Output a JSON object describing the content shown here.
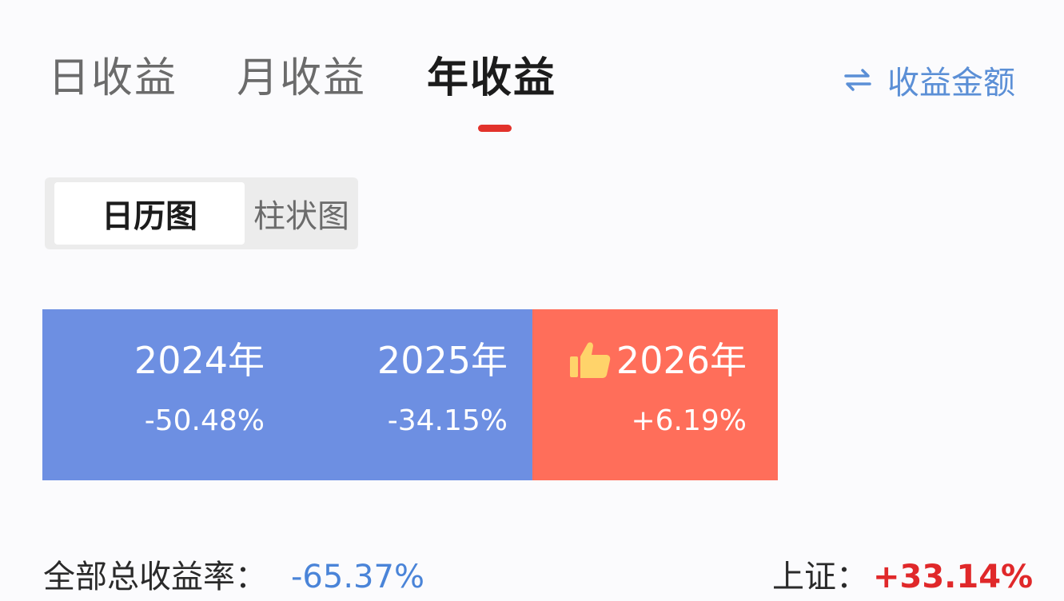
{
  "tabs": [
    {
      "label": "日收益",
      "active": false
    },
    {
      "label": "月收益",
      "active": false
    },
    {
      "label": "年收益",
      "active": true
    }
  ],
  "switch_label": "收益金额",
  "switch_icon": "swap-arrows-icon",
  "view_toggle": [
    {
      "label": "日历图",
      "selected": true
    },
    {
      "label": "柱状图",
      "selected": false
    }
  ],
  "years": [
    {
      "year": "2024年",
      "return": "-50.48%",
      "status": "loss"
    },
    {
      "year": "2025年",
      "return": "-34.15%",
      "status": "loss"
    },
    {
      "year": "2026年",
      "return": "+6.19%",
      "status": "gain",
      "badge_icon": "thumbs-up-icon"
    }
  ],
  "summary": {
    "total_label": "全部总收益率：",
    "total_value": "-65.37%",
    "index_label": "上证：",
    "index_value": "+33.14%"
  },
  "colors": {
    "accent_red": "#e2322b",
    "loss_blue": "#6d8fe2",
    "gain_coral": "#ff6e5a",
    "link_blue": "#5b8fd6"
  }
}
